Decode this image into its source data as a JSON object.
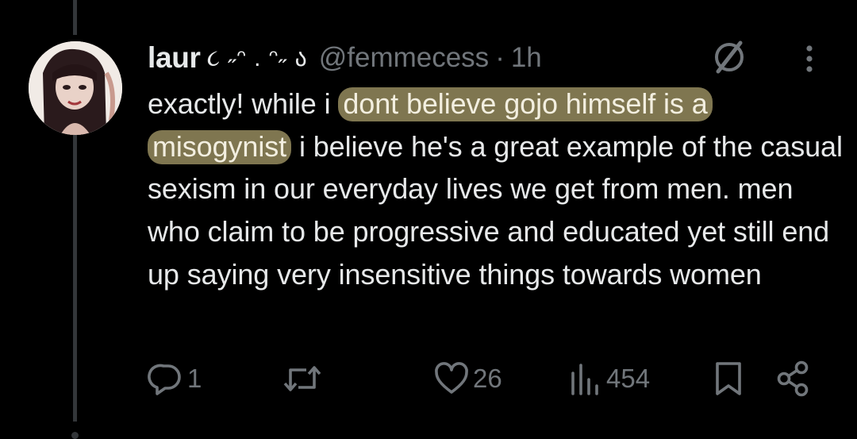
{
  "tweet": {
    "display_name": "laur",
    "name_decoration": "૮ ˶ᵔ . ᵔ˶ ა",
    "handle": "@femmecess",
    "separator": "·",
    "time": "1h",
    "text_before": "exactly! while i ",
    "text_highlighted": "dont believe gojo himself is a misogynist",
    "text_after": " i believe he's a great example of the casual sexism in our everyday lives we get from men. men who claim to be progressive and educated yet still end up saying very insensitive things towards women"
  },
  "actions": {
    "replies": "1",
    "reposts": "",
    "likes": "26",
    "views": "454"
  },
  "colors": {
    "background": "#000000",
    "text": "#e7e9ea",
    "muted": "#71767b",
    "highlight": "#7f7650",
    "thread_line": "#333639"
  },
  "icons": [
    "grok-icon",
    "more-icon",
    "reply-icon",
    "retweet-icon",
    "like-icon",
    "views-icon",
    "bookmark-icon",
    "share-icon"
  ]
}
